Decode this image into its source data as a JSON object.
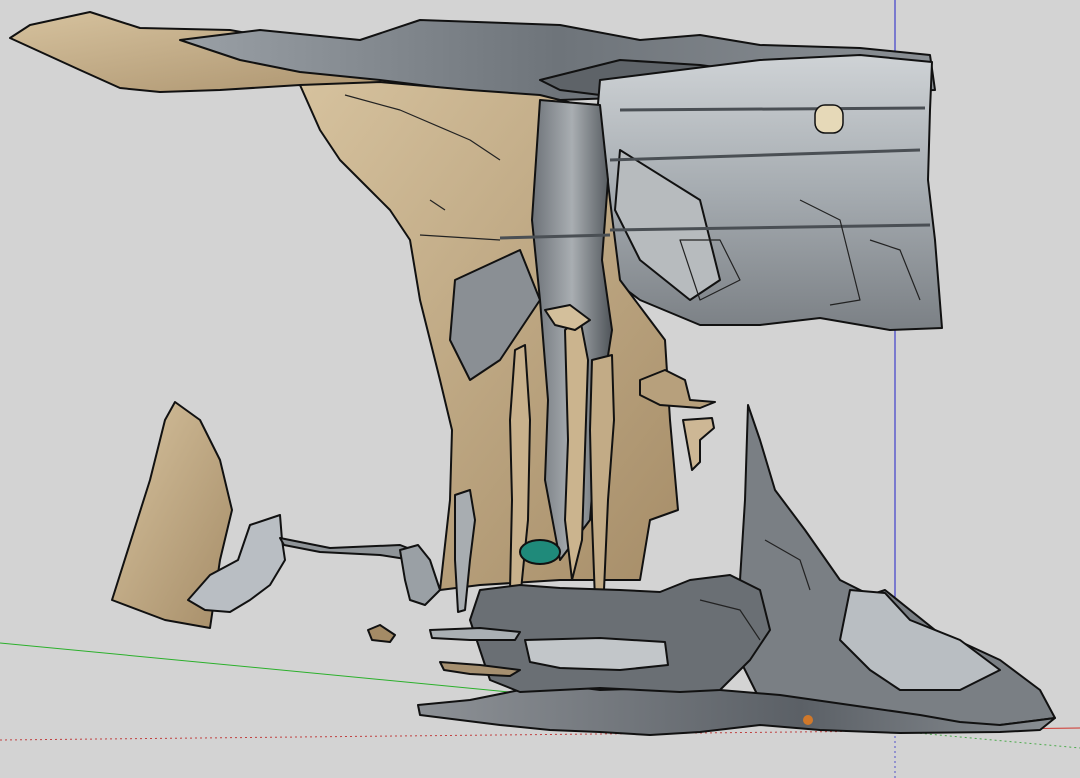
{
  "app": {
    "viewport_background": "#d3d3d3"
  },
  "colors": {
    "axis_green": "#2bb02b",
    "axis_red": "#d0342c",
    "axis_blue": "#2020c8",
    "outline": "#111111",
    "tan": "#b9a27f",
    "tan_light": "#cdb795",
    "steel": "#9ea3a8",
    "steel_light": "#c7cbce",
    "steel_dark": "#5e6368",
    "shadow": "#3c3f43",
    "teal": "#1f8a7a",
    "orange": "#d0782a"
  },
  "model": {
    "name_icon": "3d-point-cloud-mesh"
  }
}
